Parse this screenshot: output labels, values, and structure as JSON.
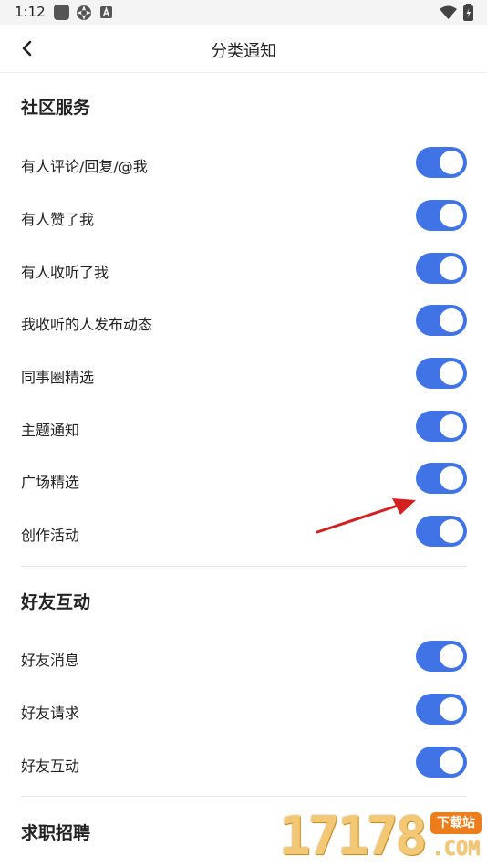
{
  "status_bar": {
    "time": "1:12",
    "icons": [
      "square-app-icon",
      "aperture-icon",
      "a-badge-icon",
      "wifi-icon",
      "battery-icon"
    ]
  },
  "app_bar": {
    "title": "分类通知",
    "back_icon": "chevron-left-icon"
  },
  "sections": [
    {
      "title": "社区服务",
      "items": [
        {
          "label": "有人评论/回复/@我",
          "on": true
        },
        {
          "label": "有人赞了我",
          "on": true
        },
        {
          "label": "有人收听了我",
          "on": true
        },
        {
          "label": "我收听的人发布动态",
          "on": true
        },
        {
          "label": "同事圈精选",
          "on": true
        },
        {
          "label": "主题通知",
          "on": true
        },
        {
          "label": "广场精选",
          "on": true
        },
        {
          "label": "创作活动",
          "on": true
        }
      ]
    },
    {
      "title": "好友互动",
      "items": [
        {
          "label": "好友消息",
          "on": true
        },
        {
          "label": "好友请求",
          "on": true
        },
        {
          "label": "好友互动",
          "on": true
        }
      ]
    },
    {
      "title": "求职招聘",
      "items": []
    }
  ],
  "colors": {
    "toggle_on": "#3f73e6",
    "annotation_arrow": "#d42020",
    "watermark_gold": "#f3c774",
    "watermark_tag": "#ed7d1a"
  },
  "watermark": {
    "digits": "17178",
    "tag": "下载站",
    "domain": ".COM"
  }
}
